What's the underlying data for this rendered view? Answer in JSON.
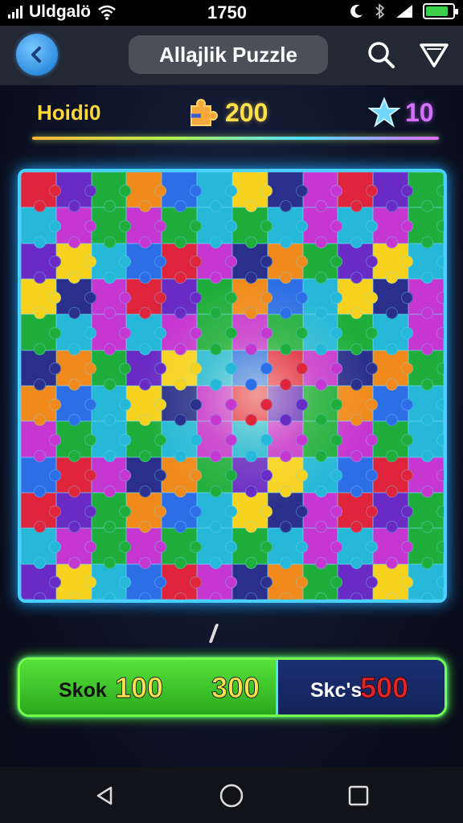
{
  "status_bar": {
    "carrier": "Uldgalö",
    "time": "1750",
    "battery_level": 0.85
  },
  "header": {
    "title": "Allajlik Puzzle",
    "back_icon": "arrow-left-icon",
    "search_icon": "search-icon",
    "filter_icon": "triangle-icon"
  },
  "scores": {
    "label": "Hoidi0",
    "coins": "200",
    "stars": "10"
  },
  "board": {
    "rows": 12,
    "cols": 12,
    "palette": [
      "#e0243c",
      "#1fae3c",
      "#2d6ee6",
      "#f7d21e",
      "#c636d0",
      "#6a2bc4",
      "#f08a1c",
      "#25b8d8",
      "#2a2f8c"
    ]
  },
  "score_bar": {
    "left_label": "Skok",
    "left_value": "100",
    "mid_value": "300",
    "right_label": "Skc's",
    "right_value": "500"
  },
  "nav_bar": {
    "back": "triangle-back-icon",
    "home": "circle-home-icon",
    "recents": "square-recents-icon"
  },
  "colors": {
    "board_border": "#49d0ff",
    "score_green": "#57e23a",
    "score_blue": "#1a2e72",
    "accent_yellow": "#ffe04a",
    "accent_purple": "#d670ff"
  }
}
